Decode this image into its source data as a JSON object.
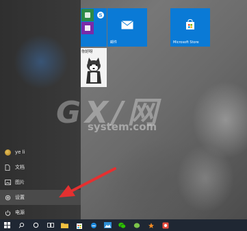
{
  "start_menu": {
    "user_name": "ye li",
    "items": [
      {
        "label": "文档",
        "icon": "document-icon"
      },
      {
        "label": "图片",
        "icon": "picture-icon"
      },
      {
        "label": "设置",
        "icon": "settings-gear-icon"
      },
      {
        "label": "电源",
        "icon": "power-icon"
      }
    ]
  },
  "tiles": {
    "mail_label": "邮件",
    "store_label": "Microsoft Store",
    "photo_caption": "你好呀"
  },
  "watermark": {
    "big": "GX/网",
    "small": "system.com"
  },
  "taskbar": {
    "icons": [
      "windows-start-icon",
      "search-icon",
      "cortana-icon",
      "task-view-icon",
      "file-explorer-icon",
      "store-icon",
      "edge-icon",
      "photos-icon",
      "wechat-icon",
      "wechat-work-icon",
      "app-icon",
      "app-icon"
    ]
  },
  "colors": {
    "accent": "#0a7ad6",
    "start_bg": "#333333",
    "taskbar_bg": "#1f2733",
    "arrow": "#e53030"
  }
}
